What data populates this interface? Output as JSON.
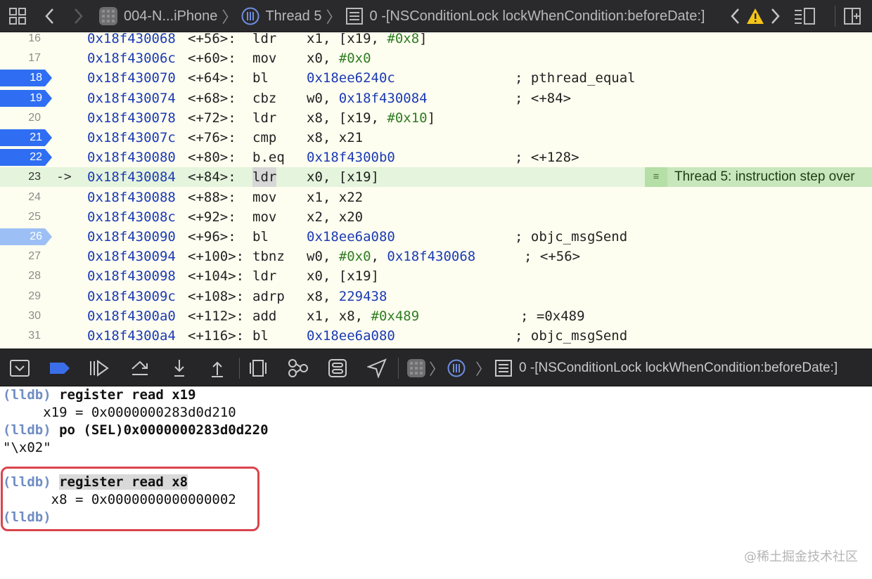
{
  "jumpbar": {
    "breadcrumb_app": "004-N...iPhone",
    "breadcrumb_thread": "Thread 5",
    "breadcrumb_frame": "0 -[NSConditionLock lockWhenCondition:beforeDate:]"
  },
  "disassembly": {
    "rows": [
      {
        "line": "16",
        "addr": "0x18f430068",
        "off": "<+56>:",
        "mn": "ldr",
        "ops": [
          {
            "t": "x1, [x19, "
          },
          {
            "t": "#0x8",
            "c": "imm"
          },
          {
            "t": "]"
          }
        ],
        "comment": "",
        "bp": ""
      },
      {
        "line": "17",
        "addr": "0x18f43006c",
        "off": "<+60>:",
        "mn": "mov",
        "ops": [
          {
            "t": "x0, "
          },
          {
            "t": "#0x0",
            "c": "imm"
          }
        ],
        "comment": "",
        "bp": ""
      },
      {
        "line": "18",
        "addr": "0x18f430070",
        "off": "<+64>:",
        "mn": "bl",
        "ops": [
          {
            "t": "0x18ee6240c",
            "c": "num"
          }
        ],
        "comment": "; pthread_equal",
        "bp": "on"
      },
      {
        "line": "19",
        "addr": "0x18f430074",
        "off": "<+68>:",
        "mn": "cbz",
        "ops": [
          {
            "t": "w0, "
          },
          {
            "t": "0x18f430084",
            "c": "num"
          }
        ],
        "comment": "; <+84>",
        "bp": "on"
      },
      {
        "line": "20",
        "addr": "0x18f430078",
        "off": "<+72>:",
        "mn": "ldr",
        "ops": [
          {
            "t": "x8, [x19, "
          },
          {
            "t": "#0x10",
            "c": "imm"
          },
          {
            "t": "]"
          }
        ],
        "comment": "",
        "bp": ""
      },
      {
        "line": "21",
        "addr": "0x18f43007c",
        "off": "<+76>:",
        "mn": "cmp",
        "ops": [
          {
            "t": "x8, x21"
          }
        ],
        "comment": "",
        "bp": "on"
      },
      {
        "line": "22",
        "addr": "0x18f430080",
        "off": "<+80>:",
        "mn": "b.eq",
        "ops": [
          {
            "t": "0x18f4300b0",
            "c": "num"
          }
        ],
        "comment": "; <+128>",
        "bp": "on"
      },
      {
        "line": "23",
        "addr": "0x18f430084",
        "off": "<+84>:",
        "mn": "ldr",
        "ops": [
          {
            "t": "x0, [x19]"
          }
        ],
        "comment": "",
        "bp": "",
        "current": true,
        "arrow": "->"
      },
      {
        "line": "24",
        "addr": "0x18f430088",
        "off": "<+88>:",
        "mn": "mov",
        "ops": [
          {
            "t": "x1, x22"
          }
        ],
        "comment": "",
        "bp": ""
      },
      {
        "line": "25",
        "addr": "0x18f43008c",
        "off": "<+92>:",
        "mn": "mov",
        "ops": [
          {
            "t": "x2, x20"
          }
        ],
        "comment": "",
        "bp": ""
      },
      {
        "line": "26",
        "addr": "0x18f430090",
        "off": "<+96>:",
        "mn": "bl",
        "ops": [
          {
            "t": "0x18ee6a080",
            "c": "num"
          }
        ],
        "comment": "; objc_msgSend",
        "bp": "off"
      },
      {
        "line": "27",
        "addr": "0x18f430094",
        "off": "<+100>:",
        "mn": "tbnz",
        "ops": [
          {
            "t": "w0, "
          },
          {
            "t": "#0x0",
            "c": "imm"
          },
          {
            "t": ", "
          },
          {
            "t": "0x18f430068",
            "c": "num"
          }
        ],
        "comment": "; <+56>",
        "bp": "",
        "cmx": 745
      },
      {
        "line": "28",
        "addr": "0x18f430098",
        "off": "<+104>:",
        "mn": "ldr",
        "ops": [
          {
            "t": "x0, [x19]"
          }
        ],
        "comment": "",
        "bp": ""
      },
      {
        "line": "29",
        "addr": "0x18f43009c",
        "off": "<+108>:",
        "mn": "adrp",
        "ops": [
          {
            "t": "x8, "
          },
          {
            "t": "229438",
            "c": "num"
          }
        ],
        "comment": "",
        "bp": ""
      },
      {
        "line": "30",
        "addr": "0x18f4300a0",
        "off": "<+112>:",
        "mn": "add",
        "ops": [
          {
            "t": "x1, x8, "
          },
          {
            "t": "#0x489",
            "c": "imm"
          }
        ],
        "comment": "; =0x489",
        "bp": "",
        "cmx": 740
      },
      {
        "line": "31",
        "addr": "0x18f4300a4",
        "off": "<+116>:",
        "mn": "bl",
        "ops": [
          {
            "t": "0x18ee6a080",
            "c": "num"
          }
        ],
        "comment": "; objc_msgSend",
        "bp": ""
      }
    ],
    "annotation": "Thread 5: instruction step over"
  },
  "debugbar": {
    "frame_label": "0 -[NSConditionLock lockWhenCondition:beforeDate:]"
  },
  "console": {
    "prompt": "(lldb)",
    "line1_cmd": " register read x19",
    "line2": "     x19 = 0x0000000283d0d210",
    "line3_cmd": "po (SEL)0x0000000283d0d220",
    "line4": "\"\\x02\"",
    "line5_cmd": "register read x8",
    "line6": "      x8 = 0x0000000000000002",
    "watermark": "@稀土掘金技术社区"
  },
  "colors": {
    "breakpoint_on": "#2f6ef2",
    "breakpoint_off": "#9cc0f5",
    "current_line": "#e5f4dc",
    "annotation": "#c8e7bc",
    "highlight_box": "#d9444c"
  }
}
